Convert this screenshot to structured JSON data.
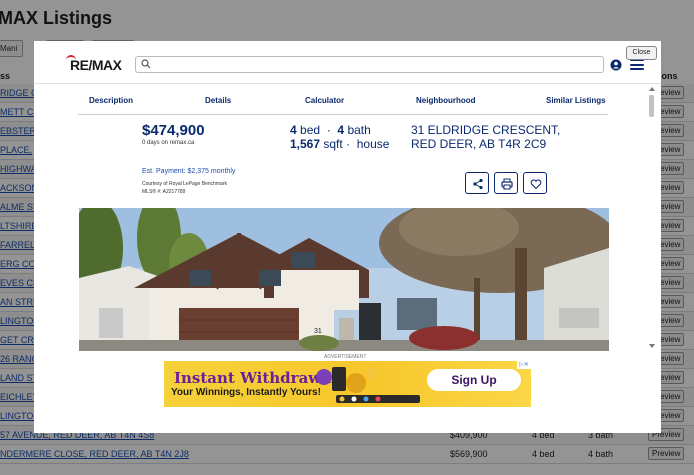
{
  "background": {
    "title": "MAX Listings",
    "toolbar_button": "Mani",
    "col_address": "ss",
    "col_actions": "ions",
    "rows": [
      {
        "addr": "RIDGE C",
        "price": "",
        "bed": "",
        "bath": ""
      },
      {
        "addr": "METT CR",
        "price": "",
        "bed": "",
        "bath": ""
      },
      {
        "addr": "EBSTER",
        "price": "",
        "bed": "",
        "bath": ""
      },
      {
        "addr": "PLACE,",
        "price": "",
        "bed": "",
        "bath": ""
      },
      {
        "addr": "HIGHWA",
        "price": "",
        "bed": "",
        "bath": ""
      },
      {
        "addr": "ACKSON",
        "price": "",
        "bed": "",
        "bath": ""
      },
      {
        "addr": "ALME ST",
        "price": "",
        "bed": "",
        "bath": ""
      },
      {
        "addr": "LTSHIRE",
        "price": "",
        "bed": "",
        "bath": ""
      },
      {
        "addr": "FARREL",
        "price": "",
        "bed": "",
        "bath": ""
      },
      {
        "addr": "ERG COU",
        "price": "",
        "bed": "",
        "bath": ""
      },
      {
        "addr": "EVES CR",
        "price": "",
        "bed": "",
        "bath": ""
      },
      {
        "addr": "AN STRE",
        "price": "",
        "bed": "",
        "bath": ""
      },
      {
        "addr": "LINGTON",
        "price": "",
        "bed": "",
        "bath": ""
      },
      {
        "addr": "GET CRE",
        "price": "",
        "bed": "",
        "bath": ""
      },
      {
        "addr": "26 RANG",
        "price": "",
        "bed": "",
        "bath": ""
      },
      {
        "addr": "LAND ST",
        "price": "",
        "bed": "",
        "bath": ""
      },
      {
        "addr": "EICHLEY",
        "price": "",
        "bed": "",
        "bath": ""
      },
      {
        "addr": "LINGTON",
        "price": "",
        "bed": "",
        "bath": ""
      },
      {
        "addr": "57 AVENUE, RED DEER, AB T4N 4S8",
        "price": "$409,900",
        "bed": "4 bed",
        "bath": "3 bath"
      },
      {
        "addr": "NDERMERE CLOSE, RED DEER, AB T4N 2J8",
        "price": "$569,900",
        "bed": "4 bed",
        "bath": "4 bath"
      }
    ],
    "preview_label": "Preview"
  },
  "modal": {
    "close_label": "Close",
    "logo": "RE/MAX",
    "search": {
      "placeholder": "",
      "value": ""
    },
    "tabs": [
      "Description",
      "Details",
      "Calculator",
      "Neighbourhood",
      "Similar Listings"
    ],
    "price": "$474,900",
    "days_on_site": "0 days on remax.ca",
    "est_payment": "Est. Payment: $2,375 monthly",
    "courtesy": "Courtesy of Royal LePage Benchmark",
    "mls": "MLS® #: A2217789",
    "beds_num": "4",
    "beds_label": "bed",
    "baths_num": "4",
    "baths_label": "bath",
    "sqft_num": "1,567",
    "sqft_label": "sqft",
    "property_type": "house",
    "address": "31 ELDRIDGE CRESCENT, RED DEER, AB T4R 2C9",
    "photo_house_number": "31",
    "ad": {
      "label": "ADVERTISEMENT",
      "headline": "Instant Withdrawals",
      "subline": "Your Winnings, Instantly Yours!",
      "cta": "Sign Up",
      "badge": "▷✕"
    }
  },
  "colors": {
    "brand_navy": "#0b2a6e",
    "brand_red": "#d42027",
    "link_blue": "#1a4fb0",
    "ad_yellow": "#f7c72c",
    "ad_purple": "#6a1f9a"
  }
}
